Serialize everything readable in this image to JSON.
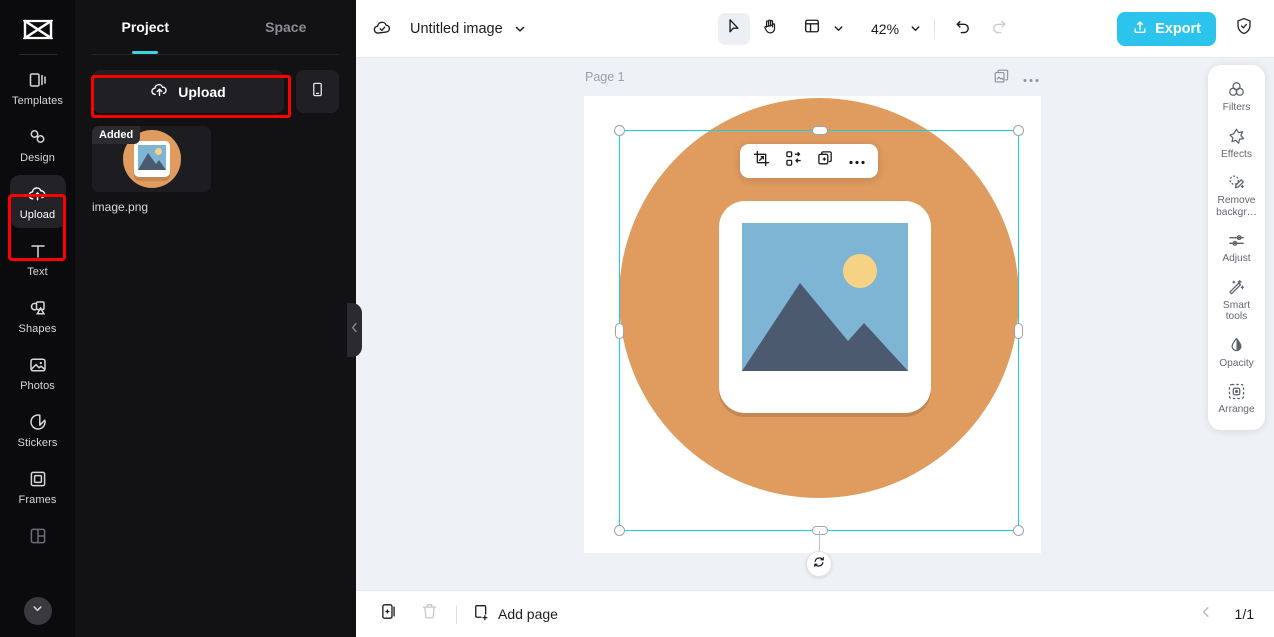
{
  "app": {
    "logo_icon": "capcut-logo-icon",
    "accent_color": "#2cc3ec",
    "tab_underline_color": "#3ed3e0",
    "highlight_color": "#ff0000",
    "canvas_bg": "#eef1f5",
    "selection_color": "#18cfe8"
  },
  "rail": {
    "items": [
      {
        "label": "Templates",
        "icon": "templates-icon",
        "active": false
      },
      {
        "label": "Design",
        "icon": "design-icon",
        "active": false
      },
      {
        "label": "Upload",
        "icon": "upload-cloud-icon",
        "active": true
      },
      {
        "label": "Text",
        "icon": "text-icon",
        "active": false
      },
      {
        "label": "Shapes",
        "icon": "shapes-icon",
        "active": false
      },
      {
        "label": "Photos",
        "icon": "photos-icon",
        "active": false
      },
      {
        "label": "Stickers",
        "icon": "sticker-icon",
        "active": false
      },
      {
        "label": "Frames",
        "icon": "frames-icon",
        "active": false
      }
    ],
    "more_icon": "chevron-down-icon"
  },
  "panel": {
    "tabs": [
      {
        "label": "Project",
        "active": true
      },
      {
        "label": "Space",
        "active": false
      }
    ],
    "upload_button": {
      "label": "Upload",
      "icon": "upload-cloud-icon",
      "highlighted": true
    },
    "mobile_button": {
      "icon": "mobile-phone-icon"
    },
    "assets": [
      {
        "name": "image.png",
        "badge": "Added",
        "thumb_icon": "image-placeholder-icon"
      }
    ]
  },
  "collapse_handle": {
    "icon": "chevron-left-icon"
  },
  "topbar": {
    "cloud_icon": "cloud-saved-icon",
    "title": "Untitled image",
    "title_chevron": "chevron-down-icon",
    "tools": [
      {
        "icon": "cursor-select-icon",
        "name": "select-tool",
        "active": true
      },
      {
        "icon": "hand-pan-icon",
        "name": "hand-tool",
        "active": false
      },
      {
        "icon": "layout-grid-icon",
        "name": "layout-tool",
        "active": false
      }
    ],
    "layout_chevron": "chevron-down-icon",
    "zoom": "42%",
    "zoom_chevron": "chevron-down-icon",
    "undo_icon": "undo-icon",
    "redo_icon": "redo-icon",
    "export": {
      "label": "Export",
      "icon": "export-upload-icon"
    },
    "shield_icon": "shield-check-icon"
  },
  "canvas": {
    "page_label": "Page 1",
    "page_actions": [
      {
        "icon": "duplicate-page-icon",
        "name": "duplicate-page-button"
      },
      {
        "icon": "more-dots-icon",
        "name": "page-more-button"
      }
    ],
    "float_toolbar": [
      {
        "icon": "crop-icon",
        "name": "crop-button"
      },
      {
        "icon": "replace-image-icon",
        "name": "replace-button"
      },
      {
        "icon": "duplicate-layer-icon",
        "name": "duplicate-button"
      },
      {
        "icon": "more-dots-icon",
        "name": "more-button"
      }
    ],
    "rotate_icon": "rotate-icon",
    "artwork": {
      "circle_color": "#e09b5f",
      "card_color": "#ffffff",
      "sky_color": "#7eb4d4",
      "sun_color": "#f6d384",
      "mountain_color": "#4c5a70"
    }
  },
  "right_panel": {
    "items": [
      {
        "label": "Filters",
        "icon": "filters-icon"
      },
      {
        "label": "Effects",
        "icon": "effects-star-icon"
      },
      {
        "label": "Remove\nbackgr…",
        "icon": "remove-background-icon"
      },
      {
        "label": "Adjust",
        "icon": "adjust-sliders-icon"
      },
      {
        "label": "Smart\ntools",
        "icon": "smart-tools-wand-icon"
      },
      {
        "label": "Opacity",
        "icon": "opacity-drop-icon"
      },
      {
        "label": "Arrange",
        "icon": "arrange-icon"
      }
    ]
  },
  "bottombar": {
    "duplicate_icon": "duplicate-page-icon",
    "delete_icon": "trash-icon",
    "add_page": {
      "label": "Add page",
      "icon": "add-page-icon"
    },
    "prev_icon": "chevron-left-icon",
    "page_count": "1/1"
  }
}
